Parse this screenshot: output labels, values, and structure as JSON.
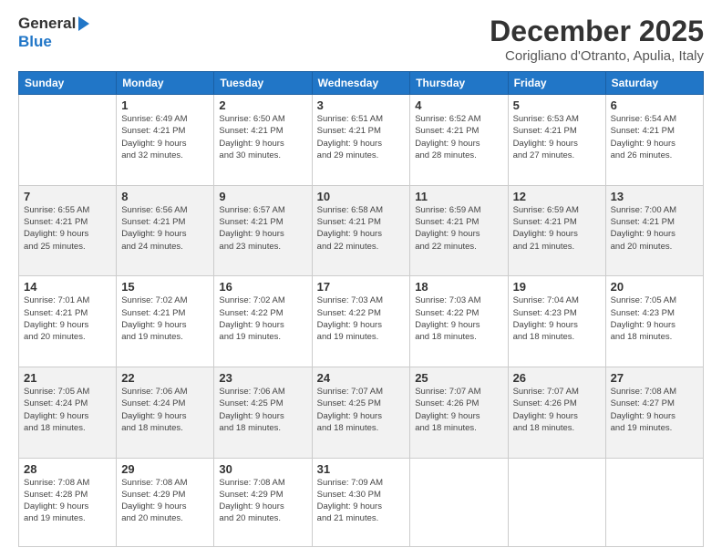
{
  "header": {
    "logo_line1": "General",
    "logo_line2": "Blue",
    "month": "December 2025",
    "location": "Corigliano d'Otranto, Apulia, Italy"
  },
  "days_of_week": [
    "Sunday",
    "Monday",
    "Tuesday",
    "Wednesday",
    "Thursday",
    "Friday",
    "Saturday"
  ],
  "weeks": [
    {
      "days": [
        {
          "date": "",
          "info": ""
        },
        {
          "date": "1",
          "info": "Sunrise: 6:49 AM\nSunset: 4:21 PM\nDaylight: 9 hours\nand 32 minutes."
        },
        {
          "date": "2",
          "info": "Sunrise: 6:50 AM\nSunset: 4:21 PM\nDaylight: 9 hours\nand 30 minutes."
        },
        {
          "date": "3",
          "info": "Sunrise: 6:51 AM\nSunset: 4:21 PM\nDaylight: 9 hours\nand 29 minutes."
        },
        {
          "date": "4",
          "info": "Sunrise: 6:52 AM\nSunset: 4:21 PM\nDaylight: 9 hours\nand 28 minutes."
        },
        {
          "date": "5",
          "info": "Sunrise: 6:53 AM\nSunset: 4:21 PM\nDaylight: 9 hours\nand 27 minutes."
        },
        {
          "date": "6",
          "info": "Sunrise: 6:54 AM\nSunset: 4:21 PM\nDaylight: 9 hours\nand 26 minutes."
        }
      ]
    },
    {
      "days": [
        {
          "date": "7",
          "info": "Sunrise: 6:55 AM\nSunset: 4:21 PM\nDaylight: 9 hours\nand 25 minutes."
        },
        {
          "date": "8",
          "info": "Sunrise: 6:56 AM\nSunset: 4:21 PM\nDaylight: 9 hours\nand 24 minutes."
        },
        {
          "date": "9",
          "info": "Sunrise: 6:57 AM\nSunset: 4:21 PM\nDaylight: 9 hours\nand 23 minutes."
        },
        {
          "date": "10",
          "info": "Sunrise: 6:58 AM\nSunset: 4:21 PM\nDaylight: 9 hours\nand 22 minutes."
        },
        {
          "date": "11",
          "info": "Sunrise: 6:59 AM\nSunset: 4:21 PM\nDaylight: 9 hours\nand 22 minutes."
        },
        {
          "date": "12",
          "info": "Sunrise: 6:59 AM\nSunset: 4:21 PM\nDaylight: 9 hours\nand 21 minutes."
        },
        {
          "date": "13",
          "info": "Sunrise: 7:00 AM\nSunset: 4:21 PM\nDaylight: 9 hours\nand 20 minutes."
        }
      ]
    },
    {
      "days": [
        {
          "date": "14",
          "info": "Sunrise: 7:01 AM\nSunset: 4:21 PM\nDaylight: 9 hours\nand 20 minutes."
        },
        {
          "date": "15",
          "info": "Sunrise: 7:02 AM\nSunset: 4:21 PM\nDaylight: 9 hours\nand 19 minutes."
        },
        {
          "date": "16",
          "info": "Sunrise: 7:02 AM\nSunset: 4:22 PM\nDaylight: 9 hours\nand 19 minutes."
        },
        {
          "date": "17",
          "info": "Sunrise: 7:03 AM\nSunset: 4:22 PM\nDaylight: 9 hours\nand 19 minutes."
        },
        {
          "date": "18",
          "info": "Sunrise: 7:03 AM\nSunset: 4:22 PM\nDaylight: 9 hours\nand 18 minutes."
        },
        {
          "date": "19",
          "info": "Sunrise: 7:04 AM\nSunset: 4:23 PM\nDaylight: 9 hours\nand 18 minutes."
        },
        {
          "date": "20",
          "info": "Sunrise: 7:05 AM\nSunset: 4:23 PM\nDaylight: 9 hours\nand 18 minutes."
        }
      ]
    },
    {
      "days": [
        {
          "date": "21",
          "info": "Sunrise: 7:05 AM\nSunset: 4:24 PM\nDaylight: 9 hours\nand 18 minutes."
        },
        {
          "date": "22",
          "info": "Sunrise: 7:06 AM\nSunset: 4:24 PM\nDaylight: 9 hours\nand 18 minutes."
        },
        {
          "date": "23",
          "info": "Sunrise: 7:06 AM\nSunset: 4:25 PM\nDaylight: 9 hours\nand 18 minutes."
        },
        {
          "date": "24",
          "info": "Sunrise: 7:07 AM\nSunset: 4:25 PM\nDaylight: 9 hours\nand 18 minutes."
        },
        {
          "date": "25",
          "info": "Sunrise: 7:07 AM\nSunset: 4:26 PM\nDaylight: 9 hours\nand 18 minutes."
        },
        {
          "date": "26",
          "info": "Sunrise: 7:07 AM\nSunset: 4:26 PM\nDaylight: 9 hours\nand 18 minutes."
        },
        {
          "date": "27",
          "info": "Sunrise: 7:08 AM\nSunset: 4:27 PM\nDaylight: 9 hours\nand 19 minutes."
        }
      ]
    },
    {
      "days": [
        {
          "date": "28",
          "info": "Sunrise: 7:08 AM\nSunset: 4:28 PM\nDaylight: 9 hours\nand 19 minutes."
        },
        {
          "date": "29",
          "info": "Sunrise: 7:08 AM\nSunset: 4:29 PM\nDaylight: 9 hours\nand 20 minutes."
        },
        {
          "date": "30",
          "info": "Sunrise: 7:08 AM\nSunset: 4:29 PM\nDaylight: 9 hours\nand 20 minutes."
        },
        {
          "date": "31",
          "info": "Sunrise: 7:09 AM\nSunset: 4:30 PM\nDaylight: 9 hours\nand 21 minutes."
        },
        {
          "date": "",
          "info": ""
        },
        {
          "date": "",
          "info": ""
        },
        {
          "date": "",
          "info": ""
        }
      ]
    }
  ]
}
